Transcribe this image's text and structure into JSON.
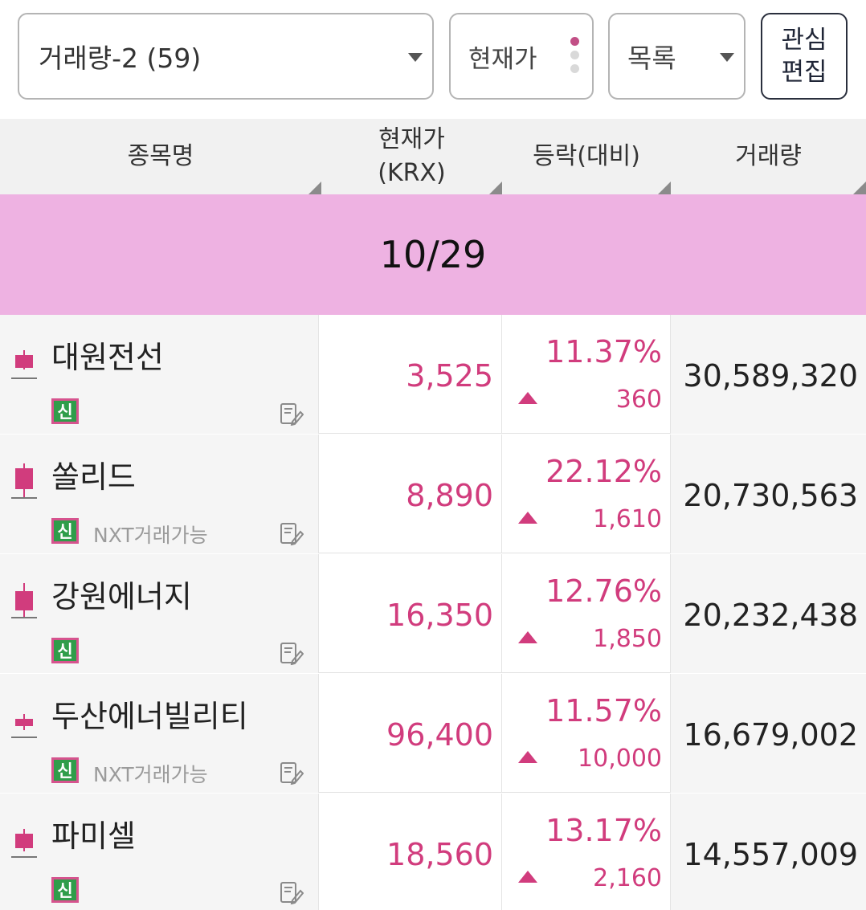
{
  "controls": {
    "group_label": "거래량-2 (59)",
    "price_type": "현재가",
    "view_mode": "목록",
    "edit_line1": "관심",
    "edit_line2": "편집"
  },
  "header": {
    "name": "종목명",
    "price_line1": "현재가",
    "price_line2": "(KRX)",
    "change": "등락(대비)",
    "volume": "거래량"
  },
  "date_label": "10/29",
  "colors": {
    "up": "#d13c7d",
    "band": "#eeb2e2",
    "badge_green": "#2f9d4a"
  },
  "rows": [
    {
      "name": "대원전선",
      "badge": "신",
      "nxt": "",
      "price": "3,525",
      "rate": "11.37%",
      "diff": "360",
      "volume": "30,589,320"
    },
    {
      "name": "쏠리드",
      "badge": "신",
      "nxt": "NXT거래가능",
      "price": "8,890",
      "rate": "22.12%",
      "diff": "1,610",
      "volume": "20,730,563"
    },
    {
      "name": "강원에너지",
      "badge": "신",
      "nxt": "",
      "price": "16,350",
      "rate": "12.76%",
      "diff": "1,850",
      "volume": "20,232,438"
    },
    {
      "name": "두산에너빌리티",
      "badge": "신",
      "nxt": "NXT거래가능",
      "price": "96,400",
      "rate": "11.57%",
      "diff": "10,000",
      "volume": "16,679,002"
    },
    {
      "name": "파미셀",
      "badge": "신",
      "nxt": "",
      "price": "18,560",
      "rate": "13.17%",
      "diff": "2,160",
      "volume": "14,557,009"
    }
  ]
}
